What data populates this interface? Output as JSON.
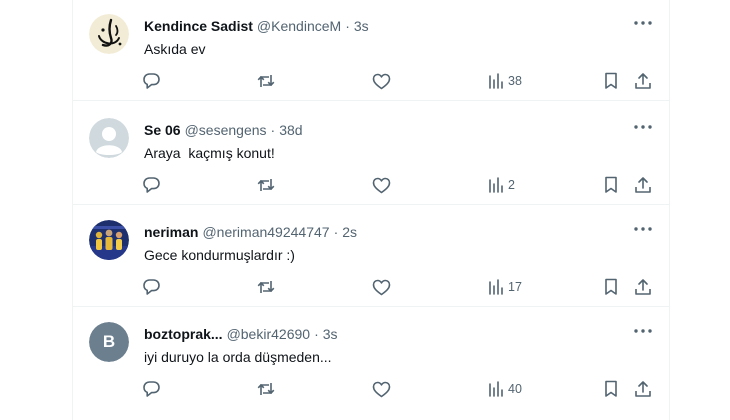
{
  "tweets": [
    {
      "display_name": "Kendince Sadist",
      "handle": "@KendinceM",
      "separator": "·",
      "time": "3s",
      "text": "Askıda ev",
      "views": "38",
      "avatar": "calligraphy-logo"
    },
    {
      "display_name": "Se 06",
      "handle": "@sesengens",
      "separator": "·",
      "time": "38d",
      "text": "Araya  kaçmış konut!",
      "views": "2",
      "avatar": "default-profile"
    },
    {
      "display_name": "neriman",
      "handle": "@neriman49244747",
      "separator": "·",
      "time": "2s",
      "text": "Gece kondurmuşlardır :)",
      "views": "17",
      "avatar": "group-photo"
    },
    {
      "display_name": "boztoprak...",
      "handle": "@bekir42690",
      "separator": "·",
      "time": "3s",
      "text": "iyi duruyo la orda düşmeden...",
      "views": "40",
      "avatar": "letter-avatar",
      "avatar_letter": "B"
    }
  ],
  "icons": [
    "more-icon",
    "reply-icon",
    "retweet-icon",
    "like-icon",
    "views-icon",
    "bookmark-icon",
    "share-icon"
  ],
  "colors": {
    "text": "#0f1419",
    "secondary": "#536471",
    "border": "#eff3f4",
    "letter_avatar_bg": "#6b7f8f"
  }
}
